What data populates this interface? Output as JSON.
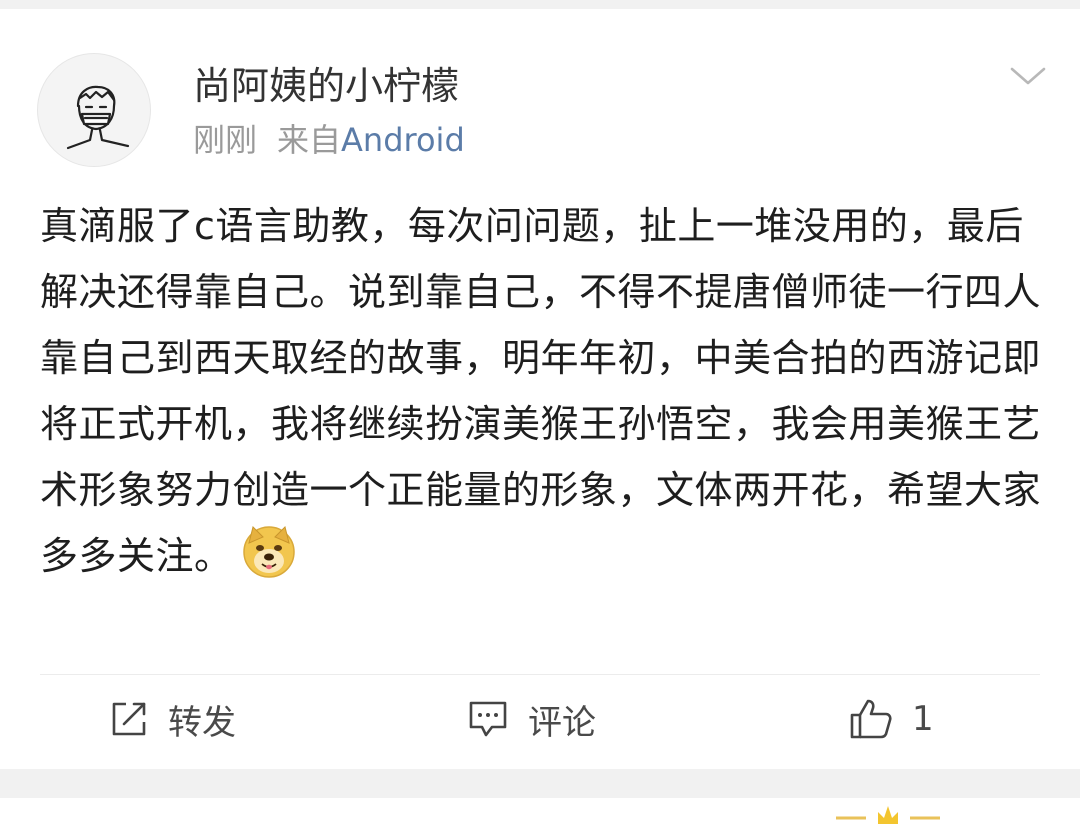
{
  "post": {
    "username": "尚阿姨的小柠檬",
    "time": "刚刚",
    "source_prefix": "来自",
    "source_device": "Android",
    "text": "真滴服了c语言助教，每次问问题，扯上一堆没用的，最后解决还得靠自己。说到靠自己，不得不提唐僧师徒一行四人靠自己到西天取经的故事，明年年初，中美合拍的西游记即将正式开机，我将继续扮演美猴王孙悟空，我会用美猴王艺术形象努力创造一个正能量的形象，文体两开花，希望大家多多关注。",
    "emoji_icon": "doge-emoji",
    "menu_icon": "chevron-down-icon"
  },
  "actions": {
    "repost_label": "转发",
    "comment_label": "评论",
    "like_count": "1"
  },
  "colors": {
    "page_bg": "#f1f1f1",
    "card_bg": "#ffffff",
    "text": "#1e1e1e",
    "meta": "#9a9a9a",
    "device_link": "#5b7ca8"
  }
}
